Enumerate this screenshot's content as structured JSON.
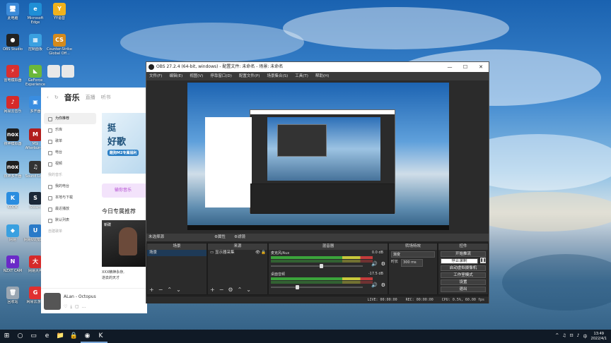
{
  "desktop": {
    "icons": [
      {
        "label": "此电脑",
        "glyph": "🖥",
        "color": "#3b8ad8"
      },
      {
        "label": "Microsoft Edge",
        "glyph": "e",
        "color": "#1f8fd6"
      },
      {
        "label": "YY语音",
        "glyph": "Y",
        "color": "#f0b21c"
      },
      {
        "label": "OBS Studio",
        "glyph": "●",
        "color": "#222222"
      },
      {
        "label": "控制面板",
        "glyph": "▦",
        "color": "#3aa0e0"
      },
      {
        "label": "Counter-Strike Global Off...",
        "glyph": "CS",
        "color": "#d48a1c"
      },
      {
        "label": "雷电模拟器",
        "glyph": "⚡",
        "color": "#d83030"
      },
      {
        "label": "GeForce Experience",
        "glyph": "◣",
        "color": "#6bb83a"
      },
      {
        "label": "",
        "glyph": "",
        "color": "#e8e8e8"
      },
      {
        "label": "",
        "glyph": "",
        "color": "#e8e8e8"
      },
      {
        "label": "网易云音乐",
        "glyph": "♪",
        "color": "#d62a2a"
      },
      {
        "label": "多开器",
        "glyph": "▣",
        "color": "#3a8de0"
      },
      {
        "label": "夜神模拟器",
        "glyph": "nox",
        "color": "#1e1e1e"
      },
      {
        "label": "MSI Afterburner",
        "glyph": "M",
        "color": "#b21e1e"
      },
      {
        "label": "夜神多开器",
        "glyph": "nox",
        "color": "#1e1e1e"
      },
      {
        "label": "Sound Lock",
        "glyph": "♫",
        "color": "#333333"
      },
      {
        "label": "KOOK",
        "glyph": "K",
        "color": "#2a8de0"
      },
      {
        "label": "Steam",
        "glyph": "S",
        "color": "#1b2838"
      },
      {
        "label": "网易",
        "glyph": "◆",
        "color": "#3aa0e0"
      },
      {
        "label": "网易UU加速器",
        "glyph": "U",
        "color": "#2a7ac8"
      },
      {
        "label": "NZXT CAM",
        "glyph": "N",
        "color": "#6a2ac8"
      },
      {
        "label": "网易大神",
        "glyph": "大",
        "color": "#d62a2a"
      },
      {
        "label": "回收站",
        "glyph": "🗑",
        "color": "#9aa6b2"
      },
      {
        "label": "网易云游戏",
        "glyph": "G",
        "color": "#e03030"
      }
    ]
  },
  "music_app": {
    "tabs": [
      "音乐",
      "直播",
      "听书"
    ],
    "nav": [
      {
        "label": "为你推荐",
        "selected": true
      },
      {
        "label": "乐库"
      },
      {
        "label": "歌单"
      },
      {
        "label": "电台"
      },
      {
        "label": "视频"
      },
      {
        "label": "我的音乐",
        "section": true
      },
      {
        "label": "我的电台"
      },
      {
        "label": "本地与下载"
      },
      {
        "label": "最近播放"
      },
      {
        "label": "默认列表"
      },
      {
        "label": "自建歌单",
        "section": true
      }
    ],
    "banner": {
      "line1": "挺",
      "line2": "好歌",
      "line3": "酷狗M2专属福利"
    },
    "vip_label": "输你音乐",
    "section_title": "今日专属推荐",
    "album": {
      "tag": "新碟",
      "caption1": "XXX精神永存,",
      "caption2": "逝去的天才"
    },
    "player": {
      "song": "ALan - Octopus"
    }
  },
  "obs": {
    "title": "OBS 27.2.4 (64-bit, windows) - 配置文件: 未命名 - 场景: 未命名",
    "window_controls": [
      "—",
      "☐",
      "✕"
    ],
    "menu": [
      "文件(F)",
      "编辑(E)",
      "视图(V)",
      "停靠窗口(D)",
      "配置文件(P)",
      "场景集合(S)",
      "工具(T)",
      "帮助(H)"
    ],
    "source_bar": {
      "no_source": "未选择源",
      "props": "⚙属性",
      "filters": "⚙滤镜"
    },
    "docks": {
      "scenes": {
        "title": "场景",
        "items": [
          "场景"
        ]
      },
      "sources": {
        "title": "来源",
        "items": [
          "显示器采集"
        ]
      },
      "mixer": {
        "title": "混音器",
        "tracks": [
          {
            "name": "麦克风/Aux",
            "db": "0.0 dB",
            "level": 0.55
          },
          {
            "name": "桌面音频",
            "db": "-17.5 dB",
            "level": 0.28
          }
        ]
      },
      "transitions": {
        "title": "转场特效",
        "type": "渐变",
        "duration_label": "时长",
        "duration": "300 ms"
      },
      "controls": {
        "title": "控件",
        "buttons": [
          "开始推流",
          "停止录制",
          "启动虚拟摄像机",
          "工作室模式",
          "设置",
          "退出"
        ]
      }
    },
    "status": {
      "live": "LIVE: 00:00:00",
      "rec": "REC: 00:00:00",
      "cpu": "CPU: 0.5%, 60.00 fps"
    }
  },
  "taskbar": {
    "apps": [
      "⊞",
      "○",
      "▭",
      "e",
      "📁",
      "🔒",
      "◉",
      "K"
    ],
    "tray": [
      "^",
      "♫",
      "⊡",
      "♪",
      "中"
    ],
    "time": "13:49",
    "date": "2022/4/1"
  }
}
